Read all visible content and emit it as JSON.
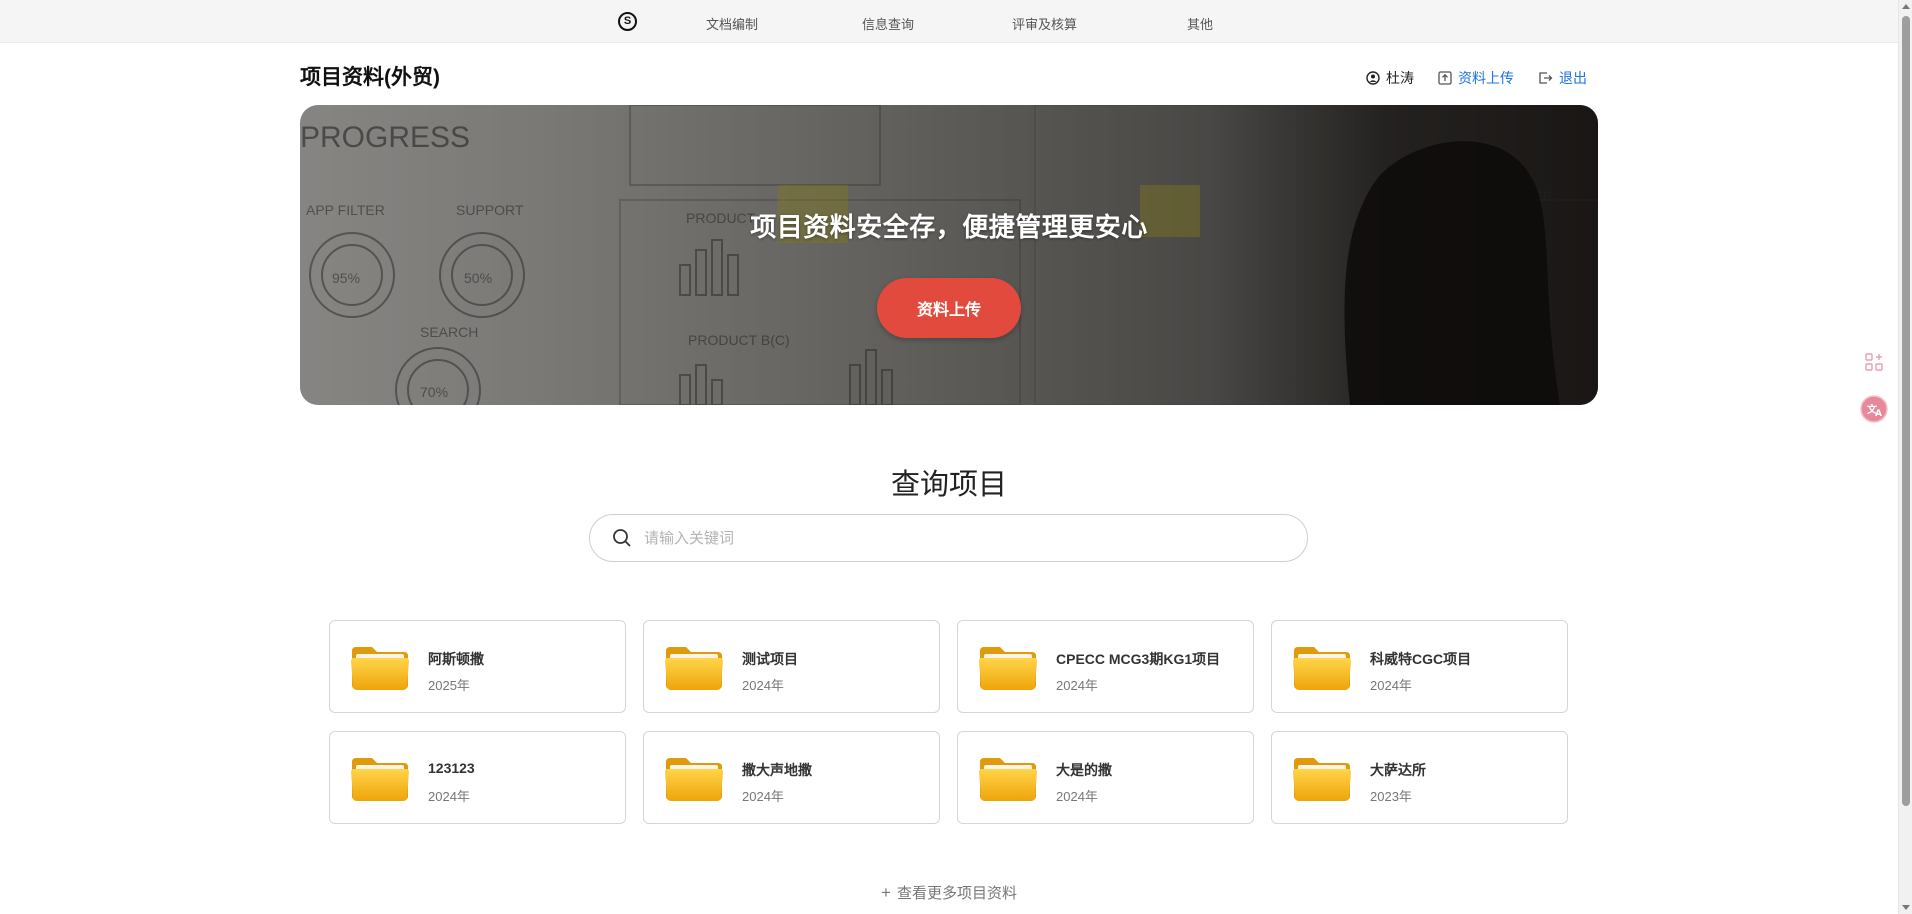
{
  "nav": {
    "logo_icon": "s-logo-icon",
    "items": [
      "文档编制",
      "信息查询",
      "评审及核算",
      "其他"
    ]
  },
  "header": {
    "title": "项目资料(外贸)",
    "user_name": "杜涛",
    "upload_label": "资料上传",
    "logout_label": "退出"
  },
  "banner": {
    "headline": "项目资料安全存，便捷管理更安心",
    "button_label": "资料上传",
    "button_color": "#e14a3c"
  },
  "search": {
    "title": "查询项目",
    "placeholder": "请输入关键词"
  },
  "projects": [
    {
      "name": "阿斯顿撒",
      "year": "2025年"
    },
    {
      "name": "测试项目",
      "year": "2024年"
    },
    {
      "name": "CPECC MCG3期KG1项目",
      "year": "2024年"
    },
    {
      "name": "科威特CGC项目",
      "year": "2024年"
    },
    {
      "name": "123123",
      "year": "2024年"
    },
    {
      "name": "撒大声地撒",
      "year": "2024年"
    },
    {
      "name": "大是的撒",
      "year": "2024年"
    },
    {
      "name": "大萨达所",
      "year": "2023年"
    }
  ],
  "more": {
    "label": "查看更多项目资料"
  },
  "side_icons": [
    "apps-add-icon",
    "translate-icon"
  ],
  "colors": {
    "link_blue": "#1a73e8",
    "folder_yellow": "#f5b814"
  }
}
